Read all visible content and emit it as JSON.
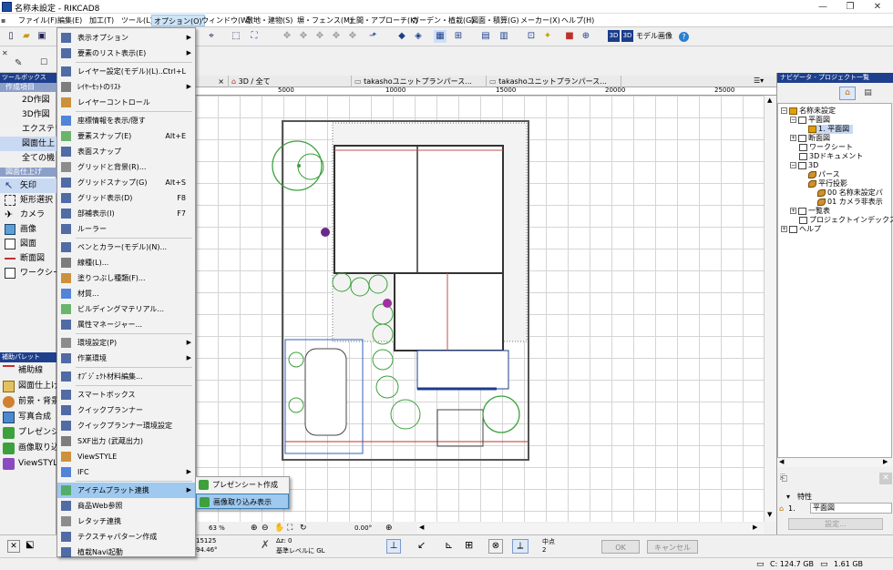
{
  "window": {
    "title": "名称未設定 - RIKCAD8",
    "controls": [
      "—",
      "❐",
      "✕"
    ]
  },
  "menubar": [
    "ファイル(F)",
    "編集(E)",
    "加工(T)",
    "ツール(L)",
    "オプション(O)",
    "ウィンドウ(W)",
    "敷地・建物(S)",
    "塀・フェンス(M)",
    "土間・アプローチ(K)",
    "ガーデン・植栽(G)",
    "図面・積算(G)",
    "メーカー(X)",
    "ヘルプ(H)"
  ],
  "toolbar": {
    "model_label": "モデル画像",
    "buttons": [
      "3D",
      "3D"
    ]
  },
  "left_panel": {
    "header": "ツールボックス",
    "sub1": "作成項目",
    "tool_rows": [
      "2D作図",
      "3D作図",
      "エクステリ",
      "図面仕上",
      "全ての機"
    ],
    "sub2": "図面仕上げ",
    "tools": [
      "矢印",
      "矩形選択",
      "カメラ",
      "画像",
      "図面",
      "断面図",
      "ワークシー"
    ],
    "palette_header": "補助パレット",
    "palette": [
      "補助線",
      "図面仕上げ",
      "前景・背景",
      "写真合成",
      "プレゼンシ",
      "画像取り込",
      "ViewSTYLE"
    ]
  },
  "options_menu": {
    "items": [
      {
        "label": "表示オプション",
        "arrow": true
      },
      {
        "label": "要素のリスト表示(E)",
        "arrow": true
      },
      {
        "sep": true
      },
      {
        "label": "レイヤー設定(モデル)(L)...",
        "shortcut": "Ctrl+L"
      },
      {
        "label": "ﾚｲﾔｰｾｯﾄのﾘｽﾄ",
        "arrow": true
      },
      {
        "label": "レイヤーコントロール"
      },
      {
        "sep": true
      },
      {
        "label": "座標情報を表示/隠す"
      },
      {
        "label": "要素スナップ(E)",
        "shortcut": "Alt+E"
      },
      {
        "label": "表面スナップ"
      },
      {
        "label": "グリッドと背景(R)..."
      },
      {
        "label": "グリッドスナップ(G)",
        "shortcut": "Alt+S"
      },
      {
        "label": "グリッド表示(D)",
        "shortcut": "F8"
      },
      {
        "label": "部補表示(I)",
        "shortcut": "F7"
      },
      {
        "label": "ルーラー"
      },
      {
        "sep": true
      },
      {
        "label": "ペンとカラー(モデル)(N)..."
      },
      {
        "label": "線種(L)..."
      },
      {
        "label": "塗りつぶし種類(F)..."
      },
      {
        "label": "材質..."
      },
      {
        "label": "ビルディングマテリアル..."
      },
      {
        "label": "属性マネージャー..."
      },
      {
        "sep": true
      },
      {
        "label": "環境設定(P)",
        "arrow": true
      },
      {
        "label": "作業環境",
        "arrow": true
      },
      {
        "sep": true
      },
      {
        "label": "ｵﾌﾞｼﾞｪｸﾄ材料編集..."
      },
      {
        "sep": true
      },
      {
        "label": "スマートボックス"
      },
      {
        "label": "クイックプランナー"
      },
      {
        "label": "クイックプランナー環境設定"
      },
      {
        "label": "SXF出力 (武蔵出力)"
      },
      {
        "label": "ViewSTYLE"
      },
      {
        "label": "IFC",
        "arrow": true
      },
      {
        "sep": true
      },
      {
        "label": "アイテムプラット連携",
        "arrow": true,
        "highlighted": true
      },
      {
        "label": "商品Web参照"
      },
      {
        "label": "レタッチ連携"
      },
      {
        "label": "テクスチャパターン作成"
      },
      {
        "label": "植栽Navi起動"
      }
    ]
  },
  "submenu": {
    "items": [
      {
        "label": "プレゼンシート作成"
      },
      {
        "label": "画像取り込み表示",
        "highlighted": true
      }
    ]
  },
  "tabs": [
    {
      "label": "",
      "close": "×"
    },
    {
      "label": "3D / 全て",
      "close": ""
    },
    {
      "label": "takashoユニットプランパース...",
      "close": ""
    },
    {
      "label": "takashoユニットプランパース...",
      "close": ""
    }
  ],
  "ruler": {
    "marks": [
      "5000",
      "10000",
      "15000",
      "20000",
      "25000"
    ]
  },
  "navigator": {
    "header": "ナビゲータ - プロジェクト一覧",
    "tree": [
      {
        "label": "名称未設定",
        "level": 0,
        "exp": "−"
      },
      {
        "label": "平面図",
        "level": 1,
        "exp": "−"
      },
      {
        "label": "1. 平面図",
        "level": 2,
        "selected": true
      },
      {
        "label": "断面図",
        "level": 1,
        "exp": "+"
      },
      {
        "label": "ワークシート",
        "level": 1
      },
      {
        "label": "3Dドキュメント",
        "level": 1
      },
      {
        "label": "3D",
        "level": 1,
        "exp": "−"
      },
      {
        "label": "パース",
        "level": 2
      },
      {
        "label": "平行投影",
        "level": 2
      },
      {
        "label": "00 名称未設定パ",
        "level": 2
      },
      {
        "label": "01 カメラ非表示",
        "level": 2
      },
      {
        "label": "一覧表",
        "level": 1,
        "exp": "+"
      },
      {
        "label": "プロジェクトインデックス",
        "level": 1
      },
      {
        "label": "ヘルプ",
        "level": 0,
        "exp": "+"
      }
    ],
    "props_label": "特性",
    "props_value": "平面図",
    "props_button": "設定..."
  },
  "view_status": {
    "zoom": "63 %",
    "angle": "0.00°",
    "coord_x": "15125",
    "coord_angle": "94.46°",
    "delta": "Δz: 0",
    "base_level": "基準レベルに GL",
    "snap_label": "中点",
    "snap_value": "2"
  },
  "bottom_buttons": {
    "ok": "OK",
    "cancel": "キャンセル"
  },
  "statusbar": {
    "c_drive": "C: 124.7 GB",
    "memory": "1.61 GB"
  },
  "colors": {
    "highlight": "#9fc9ef",
    "panel_header": "#1e3f8d",
    "plant_green": "#3ca03c",
    "wall": "#555555"
  }
}
